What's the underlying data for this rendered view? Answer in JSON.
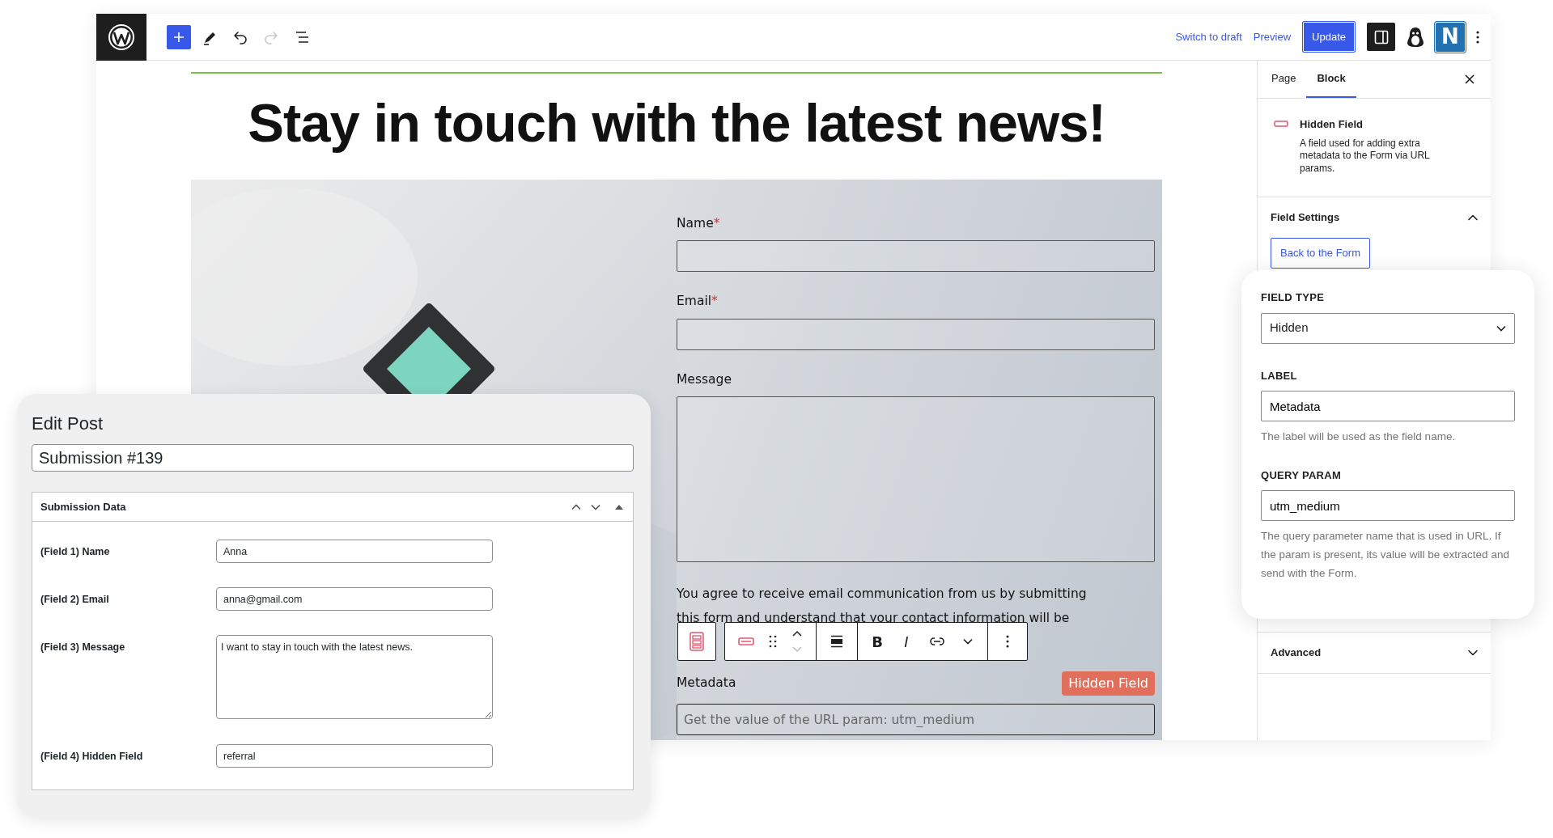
{
  "topbar": {
    "tools": [
      {
        "kind": "add",
        "disabled": false
      },
      {
        "kind": "edit",
        "disabled": false
      },
      {
        "kind": "undo",
        "disabled": false
      },
      {
        "kind": "redo",
        "disabled": true
      },
      {
        "kind": "list",
        "disabled": false
      }
    ],
    "links": [
      "Switch to draft",
      "Preview"
    ],
    "primary_button": "Update",
    "plugin_logo": "N"
  },
  "canvas": {
    "heading": "Stay in touch with the latest news!",
    "form": {
      "fields": [
        {
          "label": "Name",
          "required_mark": "*",
          "kind": "input"
        },
        {
          "label": "Email",
          "required_mark": "*",
          "kind": "input"
        },
        {
          "label": "Message",
          "kind": "textarea"
        }
      ],
      "consent": "You agree to receive email communication from us by submitting\nthis form and understand that your contact information will be",
      "block_toolbar": {
        "format_buttons": [
          "B",
          "I"
        ]
      },
      "selected_field": {
        "label": "Metadata",
        "badge": "Hidden Field",
        "placeholder": "Get the value of the URL param: utm_medium"
      }
    }
  },
  "sidebar": {
    "tabs": [
      {
        "label": "Page",
        "selected": false
      },
      {
        "label": "Block",
        "selected": true
      }
    ],
    "block": {
      "title": "Hidden Field",
      "description": "A field used for adding extra metadata to the Form via URL params."
    },
    "panels": [
      {
        "title": "Field Settings",
        "expanded": true,
        "button": "Back to the Form"
      },
      {
        "title": "Advanced",
        "expanded": false
      }
    ]
  },
  "field_settings_popup": {
    "settings": [
      {
        "label": "FIELD TYPE",
        "kind": "select",
        "value": "Hidden"
      },
      {
        "label": "LABEL",
        "kind": "text",
        "value": "Metadata",
        "help": "The label will be used as the field name."
      },
      {
        "label": "QUERY PARAM",
        "kind": "text",
        "value": "utm_medium",
        "help": "The query parameter name that is used in URL. If the param is present, its value will be extracted and send with the Form."
      }
    ]
  },
  "edit_post": {
    "title": "Edit Post",
    "post_title": "Submission #139",
    "box": {
      "title": "Submission Data",
      "rows": [
        {
          "label": "(Field 1) Name",
          "value": "Anna",
          "kind": "text"
        },
        {
          "label": "(Field 2) Email",
          "value": "anna@gmail.com",
          "kind": "text"
        },
        {
          "label": "(Field 3) Message",
          "value": "I want to stay in touch with the latest news.",
          "kind": "textarea"
        },
        {
          "label": "(Field 4) Hidden Field",
          "value": "referral",
          "kind": "text"
        }
      ]
    }
  }
}
